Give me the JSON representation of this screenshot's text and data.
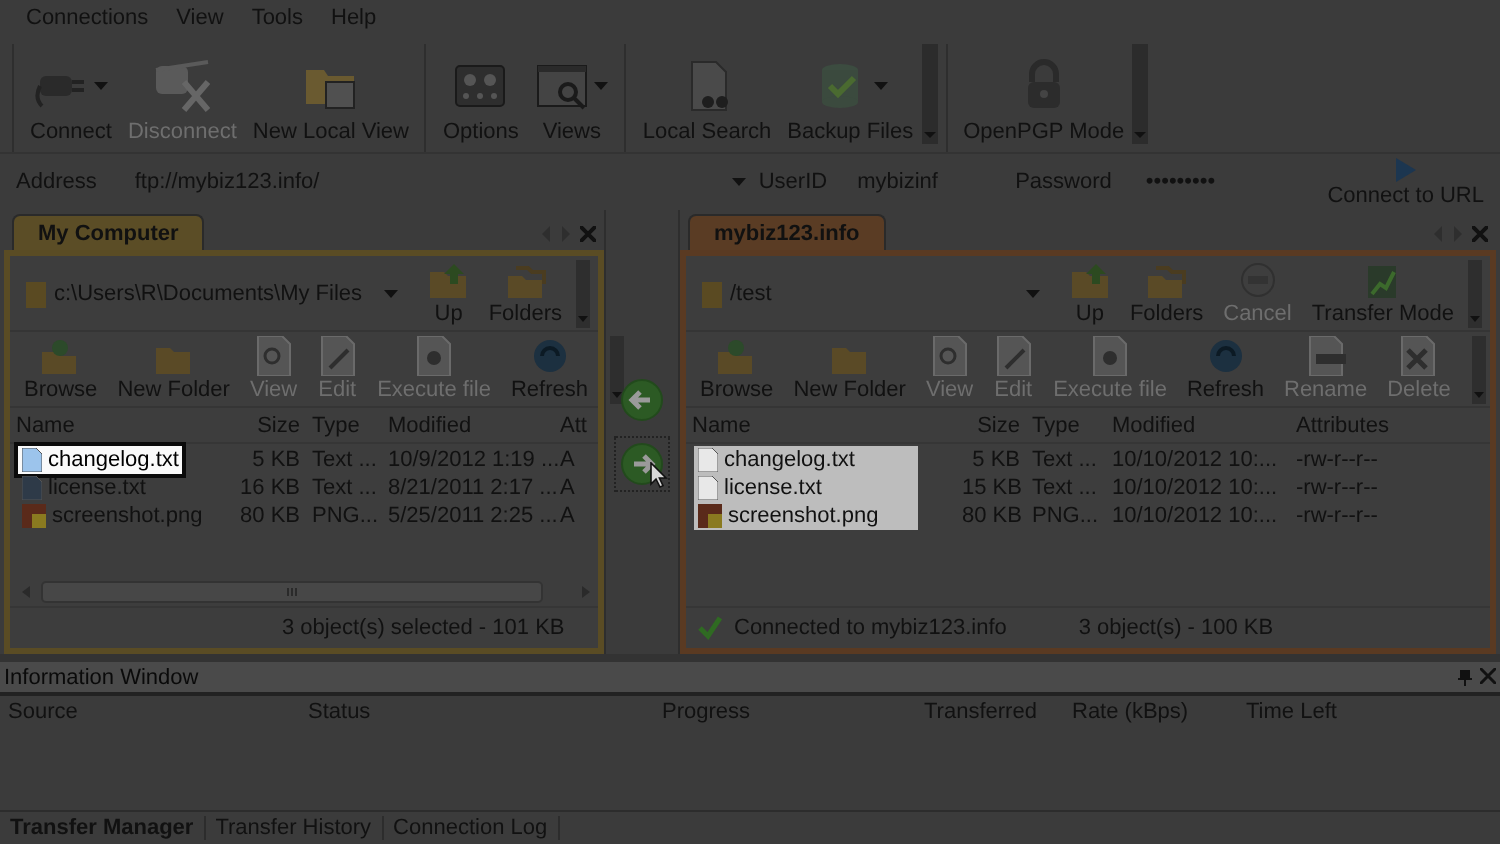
{
  "menu": [
    {
      "label": "Connections"
    },
    {
      "label": "View"
    },
    {
      "label": "Tools"
    },
    {
      "label": "Help"
    }
  ],
  "toolbar": {
    "groups": [
      [
        {
          "label": "Connect",
          "disabled": false,
          "dropdown": true
        },
        {
          "label": "Disconnect",
          "disabled": true,
          "dropdown": false
        },
        {
          "label": "New Local View",
          "disabled": false,
          "dropdown": false
        }
      ],
      [
        {
          "label": "Options",
          "disabled": false,
          "dropdown": false
        },
        {
          "label": "Views",
          "disabled": false,
          "dropdown": true
        }
      ],
      [
        {
          "label": "Local Search",
          "disabled": false,
          "dropdown": false
        },
        {
          "label": "Backup Files",
          "disabled": false,
          "dropdown": true
        }
      ],
      [
        {
          "label": "OpenPGP Mode",
          "disabled": false,
          "dropdown": false
        }
      ]
    ]
  },
  "address_bar": {
    "address_label": "Address",
    "address": "ftp://mybiz123.info/",
    "userid_label": "UserID",
    "userid": "mybizinf",
    "password_label": "Password",
    "password": "•••••••••",
    "connect_button": "Connect to URL"
  },
  "panes": [
    {
      "tab": "My Computer",
      "kind": "local",
      "path": "c:\\Users\\R\\Documents\\My Files",
      "nav_buttons": [
        {
          "label": "Up",
          "disabled": false
        },
        {
          "label": "Folders",
          "disabled": false
        }
      ],
      "action_buttons": [
        {
          "label": "Browse",
          "disabled": false
        },
        {
          "label": "New Folder",
          "disabled": false
        },
        {
          "label": "View",
          "disabled": true
        },
        {
          "label": "Edit",
          "disabled": true
        },
        {
          "label": "Execute file",
          "disabled": true
        },
        {
          "label": "Refresh",
          "disabled": false
        }
      ],
      "columns": [
        "Name",
        "Size",
        "Type",
        "Modified",
        "Att"
      ],
      "rows": [
        {
          "cells": [
            "changelog.txt",
            "5 KB",
            "Text ...",
            "10/9/2012 1:19 ...",
            "A"
          ],
          "highlighted": true
        },
        {
          "cells": [
            "license.txt",
            "16 KB",
            "Text ...",
            "8/21/2011 2:17 ...",
            "A"
          ],
          "highlighted": false
        },
        {
          "cells": [
            "screenshot.png",
            "80 KB",
            "PNG...",
            "5/25/2011 2:25 ...",
            "A"
          ],
          "highlighted": false
        }
      ],
      "status": "3 object(s) selected - 101 KB"
    },
    {
      "tab": "mybiz123.info",
      "kind": "remote",
      "path": "/test",
      "nav_buttons": [
        {
          "label": "Up",
          "disabled": false
        },
        {
          "label": "Folders",
          "disabled": false
        },
        {
          "label": "Cancel",
          "disabled": true
        },
        {
          "label": "Transfer Mode",
          "disabled": false
        }
      ],
      "action_buttons": [
        {
          "label": "Browse",
          "disabled": false
        },
        {
          "label": "New Folder",
          "disabled": false
        },
        {
          "label": "View",
          "disabled": true
        },
        {
          "label": "Edit",
          "disabled": true
        },
        {
          "label": "Execute file",
          "disabled": true
        },
        {
          "label": "Refresh",
          "disabled": false
        },
        {
          "label": "Rename",
          "disabled": true
        },
        {
          "label": "Delete",
          "disabled": true
        }
      ],
      "columns": [
        "Name",
        "Size",
        "Type",
        "Modified",
        "Attributes"
      ],
      "rows": [
        {
          "cells": [
            "changelog.txt",
            "5 KB",
            "Text ...",
            "10/10/2012 10:...",
            "-rw-r--r--"
          ],
          "highlighted": true
        },
        {
          "cells": [
            "license.txt",
            "15 KB",
            "Text ...",
            "10/10/2012 10:...",
            "-rw-r--r--"
          ],
          "highlighted": true
        },
        {
          "cells": [
            "screenshot.png",
            "80 KB",
            "PNG...",
            "10/10/2012 10:...",
            "-rw-r--r--"
          ],
          "highlighted": true
        }
      ],
      "connection": "Connected to mybiz123.info",
      "status": "3 object(s) - 100 KB"
    }
  ],
  "information_window": {
    "title": "Information Window",
    "columns": [
      "Source",
      "Status",
      "Progress",
      "Transferred",
      "Rate (kBps)",
      "Time Left"
    ],
    "tabs": [
      {
        "label": "Transfer Manager",
        "selected": true
      },
      {
        "label": "Transfer History",
        "selected": false
      },
      {
        "label": "Connection Log",
        "selected": false
      }
    ]
  }
}
